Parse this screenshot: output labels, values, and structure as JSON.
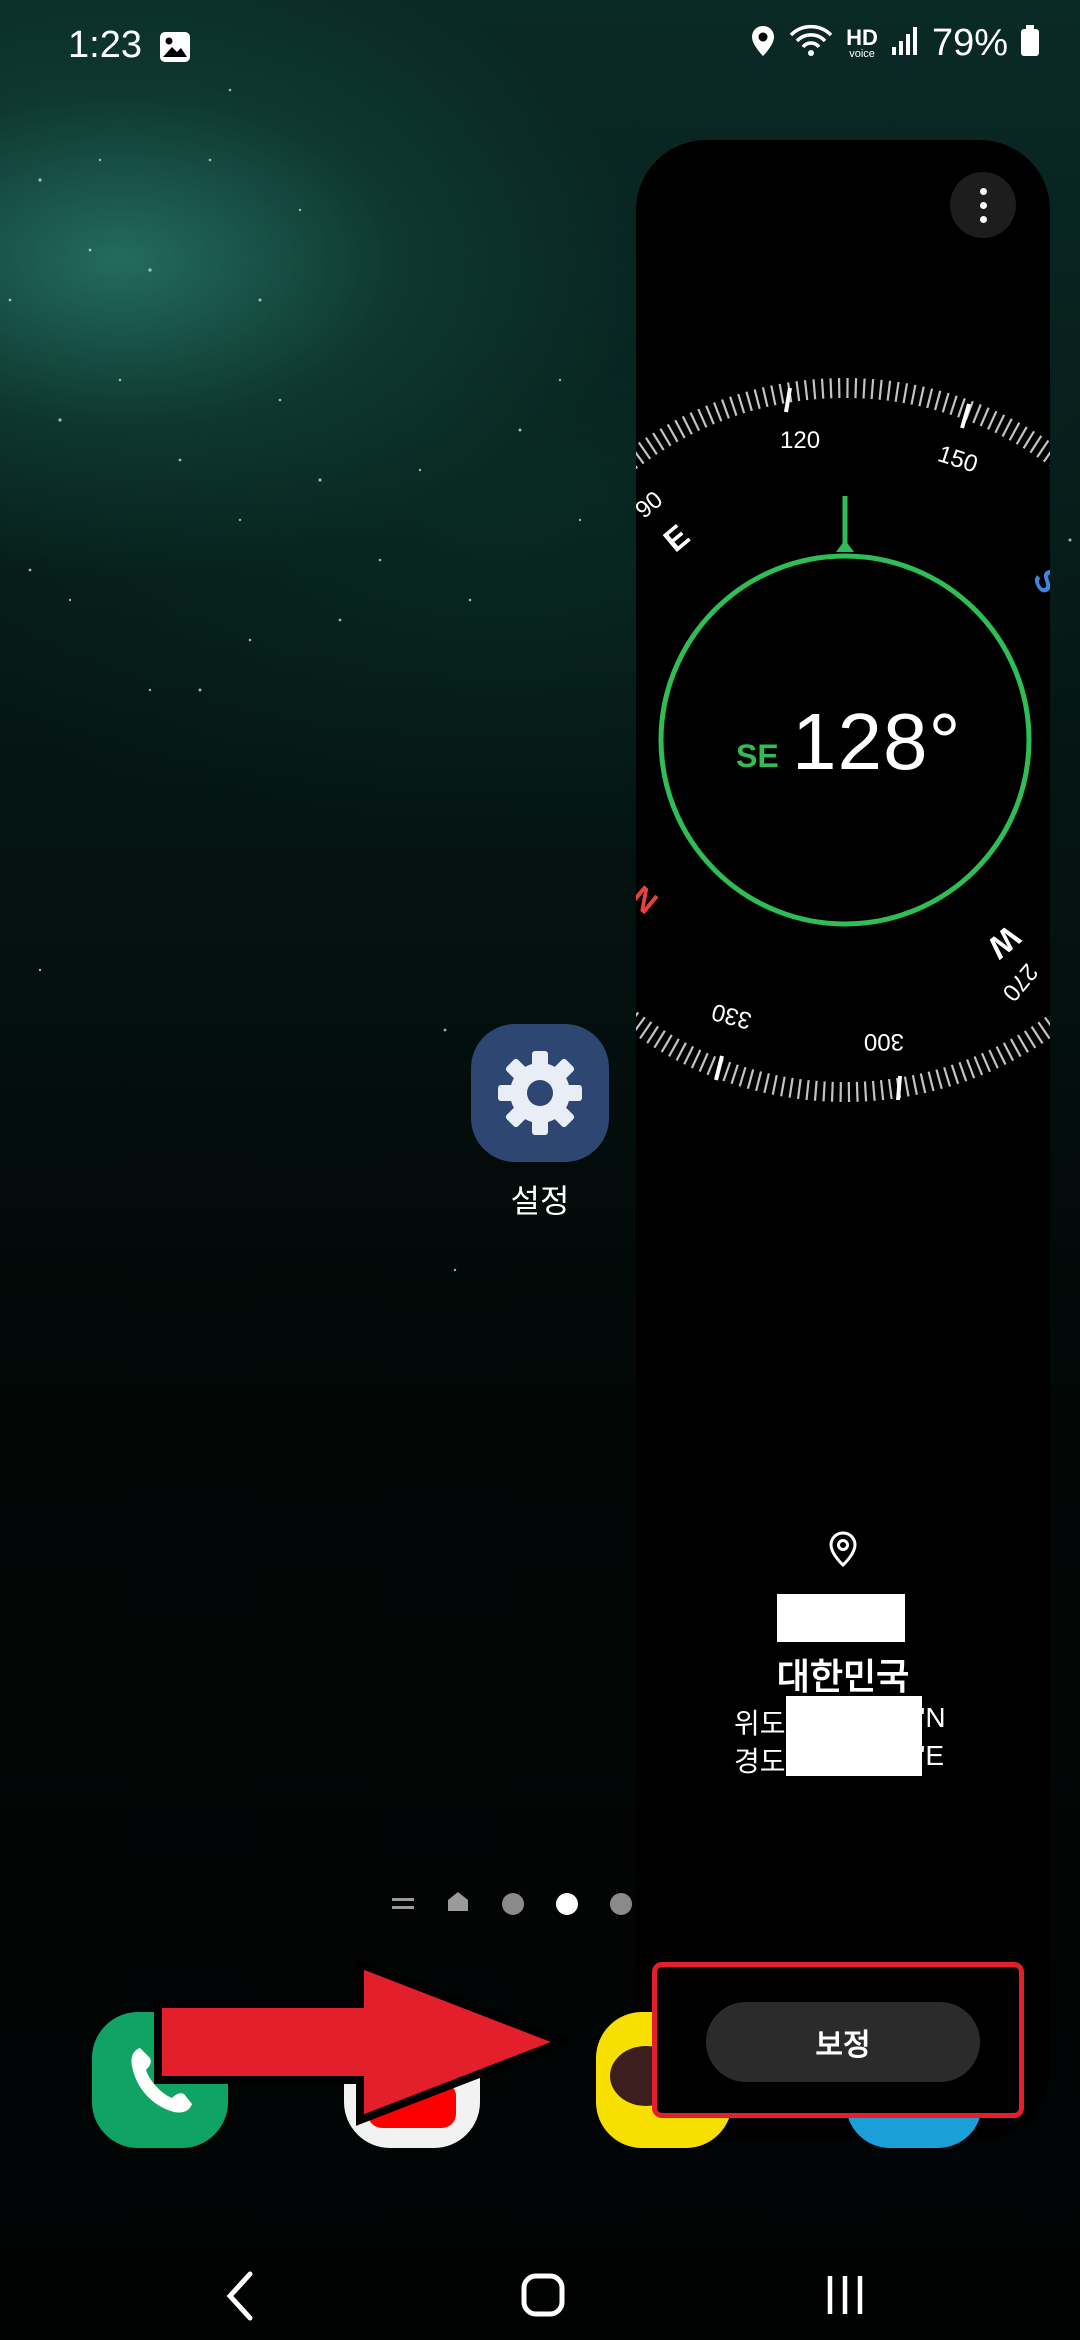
{
  "status_bar": {
    "time": "1:23",
    "hd_label": "HD",
    "voice_label": "voice",
    "battery": "79%"
  },
  "compass": {
    "heading_direction": "SE",
    "heading_degrees": "128°",
    "accent_color": "#2fbd55",
    "north_color": "#e8413c",
    "south_color": "#3f86e0",
    "dial_labels": {
      "e": "E",
      "s": "S",
      "w": "W",
      "n": "N",
      "deg_90": "90",
      "deg_120": "120",
      "deg_150": "150",
      "deg_270": "270",
      "deg_300": "300",
      "deg_330": "330"
    },
    "more_options_icon": "more-vertical-icon"
  },
  "location": {
    "icon": "location-pin-icon",
    "country": "대한민국",
    "latitude_label": "위도",
    "latitude_suffix": "'N",
    "longitude_label": "경도",
    "longitude_suffix": "'E"
  },
  "home_screen": {
    "settings_app_label": "설정",
    "settings_icon": "gear-icon"
  },
  "dock": {
    "apps": [
      "phone-app-icon",
      "youtube-app-icon",
      "kakaotalk-app-icon",
      "app-icon"
    ]
  },
  "calibrate_button_label": "보정",
  "annotation": {
    "arrow_color": "#e21f2b",
    "highlight_color": "#e21f2b"
  },
  "nav_bar": {
    "back_icon": "back-icon",
    "home_icon": "home-icon",
    "recents_icon": "recents-icon"
  }
}
